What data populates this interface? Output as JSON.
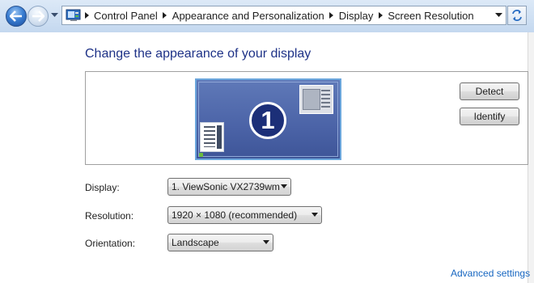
{
  "breadcrumb": [
    "Control Panel",
    "Appearance and Personalization",
    "Display",
    "Screen Resolution"
  ],
  "icons": {
    "back": "back-arrow-icon",
    "forward": "forward-arrow-icon",
    "recent": "chevron-down-icon",
    "address": "control-panel-icon",
    "refresh": "refresh-icon"
  },
  "page": {
    "title": "Change the appearance of your display"
  },
  "monitor": {
    "number": "1"
  },
  "buttons": {
    "detect": "Detect",
    "identify": "Identify"
  },
  "fields": {
    "display": {
      "label": "Display:",
      "value": "1. ViewSonic VX2739wm"
    },
    "resolution": {
      "label": "Resolution:",
      "value": "1920 × 1080 (recommended)"
    },
    "orientation": {
      "label": "Orientation:",
      "value": "Landscape"
    }
  },
  "links": {
    "advanced": "Advanced settings"
  },
  "colors": {
    "title": "#1e3287",
    "link": "#1565c0",
    "monitor_bg": "#4b63a7",
    "monitor_border": "#6ba6dc"
  }
}
